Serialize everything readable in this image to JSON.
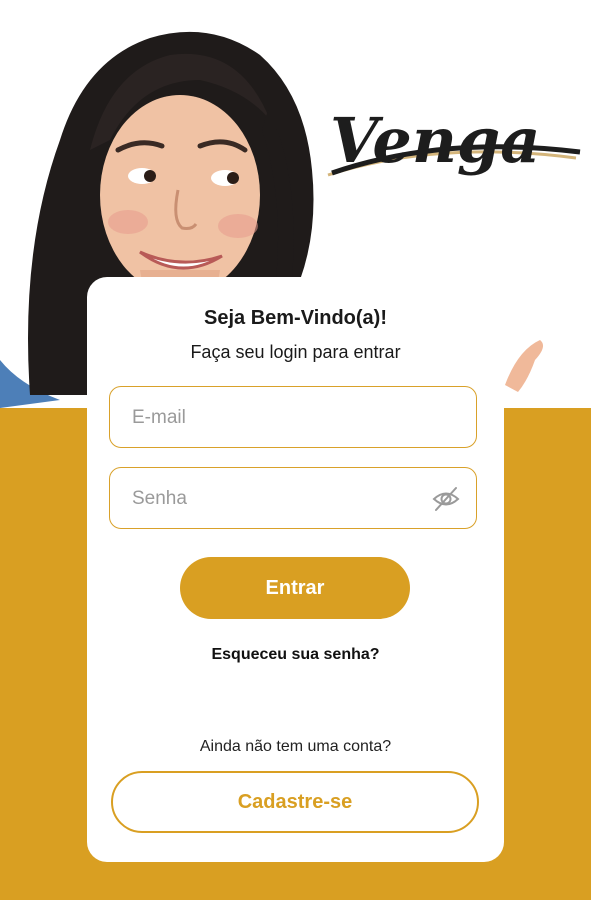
{
  "brand": {
    "logo_text": "Venga",
    "accent_color": "#d99f22"
  },
  "login_card": {
    "title": "Seja Bem-Vindo(a)!",
    "subtitle": "Faça seu login para entrar",
    "email_placeholder": "E-mail",
    "password_placeholder": "Senha",
    "password_toggle_icon": "eye-off-icon",
    "login_button": "Entrar",
    "forgot_password": "Esqueceu sua senha?",
    "no_account_text": "Ainda não tem uma conta?",
    "signup_button": "Cadastre-se"
  }
}
